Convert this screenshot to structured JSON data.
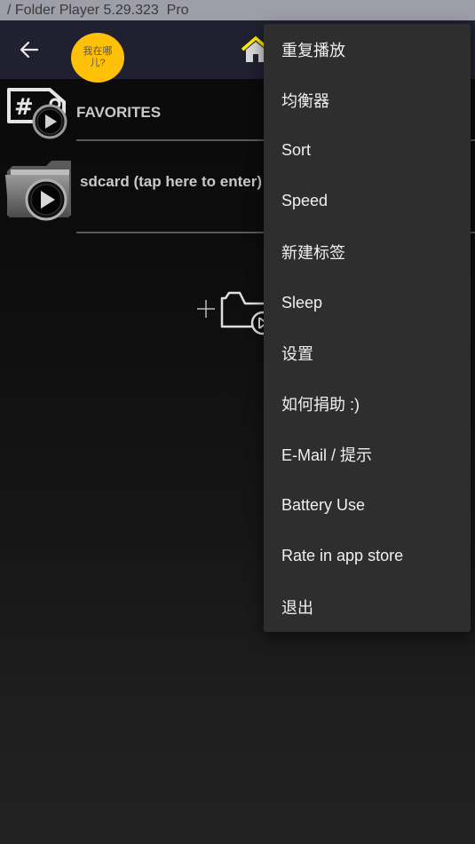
{
  "window": {
    "title": "/ Folder Player 5.29.323  Pro"
  },
  "appbar": {
    "back_icon": "arrow-left-icon",
    "where_am_i_label": "我在哪儿?",
    "home_icon": "home-icon",
    "colors": {
      "appbar_bg": "#212030",
      "where_button_bg": "#ffc107",
      "home_roof": "#ffee00"
    }
  },
  "list": {
    "items": [
      {
        "label": "FAVORITES",
        "icon": "tag-play-icon"
      },
      {
        "label": "sdcard (tap here to enter)",
        "icon": "folder-play-icon"
      }
    ],
    "add_folder_icon": "add-folder-icon"
  },
  "menu": {
    "items": [
      {
        "label": "重复播放"
      },
      {
        "label": "均衡器"
      },
      {
        "label": "Sort"
      },
      {
        "label": "Speed"
      },
      {
        "label": "新建标签"
      },
      {
        "label": "Sleep"
      },
      {
        "label": "设置"
      },
      {
        "label": "如何捐助 :)"
      },
      {
        "label": "E-Mail / 提示"
      },
      {
        "label": "Battery Use"
      },
      {
        "label": "Rate in app store"
      },
      {
        "label": "退出"
      }
    ]
  }
}
